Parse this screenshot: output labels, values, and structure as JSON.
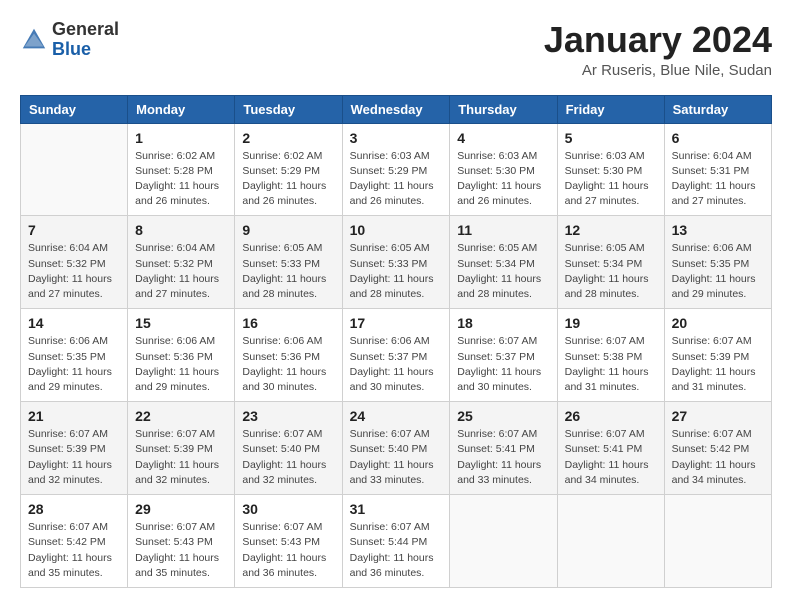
{
  "header": {
    "logo_general": "General",
    "logo_blue": "Blue",
    "month_title": "January 2024",
    "location": "Ar Ruseris, Blue Nile, Sudan"
  },
  "weekdays": [
    "Sunday",
    "Monday",
    "Tuesday",
    "Wednesday",
    "Thursday",
    "Friday",
    "Saturday"
  ],
  "weeks": [
    [
      {
        "day": "",
        "sunrise": "",
        "sunset": "",
        "daylight": ""
      },
      {
        "day": "1",
        "sunrise": "Sunrise: 6:02 AM",
        "sunset": "Sunset: 5:28 PM",
        "daylight": "Daylight: 11 hours and 26 minutes."
      },
      {
        "day": "2",
        "sunrise": "Sunrise: 6:02 AM",
        "sunset": "Sunset: 5:29 PM",
        "daylight": "Daylight: 11 hours and 26 minutes."
      },
      {
        "day": "3",
        "sunrise": "Sunrise: 6:03 AM",
        "sunset": "Sunset: 5:29 PM",
        "daylight": "Daylight: 11 hours and 26 minutes."
      },
      {
        "day": "4",
        "sunrise": "Sunrise: 6:03 AM",
        "sunset": "Sunset: 5:30 PM",
        "daylight": "Daylight: 11 hours and 26 minutes."
      },
      {
        "day": "5",
        "sunrise": "Sunrise: 6:03 AM",
        "sunset": "Sunset: 5:30 PM",
        "daylight": "Daylight: 11 hours and 27 minutes."
      },
      {
        "day": "6",
        "sunrise": "Sunrise: 6:04 AM",
        "sunset": "Sunset: 5:31 PM",
        "daylight": "Daylight: 11 hours and 27 minutes."
      }
    ],
    [
      {
        "day": "7",
        "sunrise": "Sunrise: 6:04 AM",
        "sunset": "Sunset: 5:32 PM",
        "daylight": "Daylight: 11 hours and 27 minutes."
      },
      {
        "day": "8",
        "sunrise": "Sunrise: 6:04 AM",
        "sunset": "Sunset: 5:32 PM",
        "daylight": "Daylight: 11 hours and 27 minutes."
      },
      {
        "day": "9",
        "sunrise": "Sunrise: 6:05 AM",
        "sunset": "Sunset: 5:33 PM",
        "daylight": "Daylight: 11 hours and 28 minutes."
      },
      {
        "day": "10",
        "sunrise": "Sunrise: 6:05 AM",
        "sunset": "Sunset: 5:33 PM",
        "daylight": "Daylight: 11 hours and 28 minutes."
      },
      {
        "day": "11",
        "sunrise": "Sunrise: 6:05 AM",
        "sunset": "Sunset: 5:34 PM",
        "daylight": "Daylight: 11 hours and 28 minutes."
      },
      {
        "day": "12",
        "sunrise": "Sunrise: 6:05 AM",
        "sunset": "Sunset: 5:34 PM",
        "daylight": "Daylight: 11 hours and 28 minutes."
      },
      {
        "day": "13",
        "sunrise": "Sunrise: 6:06 AM",
        "sunset": "Sunset: 5:35 PM",
        "daylight": "Daylight: 11 hours and 29 minutes."
      }
    ],
    [
      {
        "day": "14",
        "sunrise": "Sunrise: 6:06 AM",
        "sunset": "Sunset: 5:35 PM",
        "daylight": "Daylight: 11 hours and 29 minutes."
      },
      {
        "day": "15",
        "sunrise": "Sunrise: 6:06 AM",
        "sunset": "Sunset: 5:36 PM",
        "daylight": "Daylight: 11 hours and 29 minutes."
      },
      {
        "day": "16",
        "sunrise": "Sunrise: 6:06 AM",
        "sunset": "Sunset: 5:36 PM",
        "daylight": "Daylight: 11 hours and 30 minutes."
      },
      {
        "day": "17",
        "sunrise": "Sunrise: 6:06 AM",
        "sunset": "Sunset: 5:37 PM",
        "daylight": "Daylight: 11 hours and 30 minutes."
      },
      {
        "day": "18",
        "sunrise": "Sunrise: 6:07 AM",
        "sunset": "Sunset: 5:37 PM",
        "daylight": "Daylight: 11 hours and 30 minutes."
      },
      {
        "day": "19",
        "sunrise": "Sunrise: 6:07 AM",
        "sunset": "Sunset: 5:38 PM",
        "daylight": "Daylight: 11 hours and 31 minutes."
      },
      {
        "day": "20",
        "sunrise": "Sunrise: 6:07 AM",
        "sunset": "Sunset: 5:39 PM",
        "daylight": "Daylight: 11 hours and 31 minutes."
      }
    ],
    [
      {
        "day": "21",
        "sunrise": "Sunrise: 6:07 AM",
        "sunset": "Sunset: 5:39 PM",
        "daylight": "Daylight: 11 hours and 32 minutes."
      },
      {
        "day": "22",
        "sunrise": "Sunrise: 6:07 AM",
        "sunset": "Sunset: 5:39 PM",
        "daylight": "Daylight: 11 hours and 32 minutes."
      },
      {
        "day": "23",
        "sunrise": "Sunrise: 6:07 AM",
        "sunset": "Sunset: 5:40 PM",
        "daylight": "Daylight: 11 hours and 32 minutes."
      },
      {
        "day": "24",
        "sunrise": "Sunrise: 6:07 AM",
        "sunset": "Sunset: 5:40 PM",
        "daylight": "Daylight: 11 hours and 33 minutes."
      },
      {
        "day": "25",
        "sunrise": "Sunrise: 6:07 AM",
        "sunset": "Sunset: 5:41 PM",
        "daylight": "Daylight: 11 hours and 33 minutes."
      },
      {
        "day": "26",
        "sunrise": "Sunrise: 6:07 AM",
        "sunset": "Sunset: 5:41 PM",
        "daylight": "Daylight: 11 hours and 34 minutes."
      },
      {
        "day": "27",
        "sunrise": "Sunrise: 6:07 AM",
        "sunset": "Sunset: 5:42 PM",
        "daylight": "Daylight: 11 hours and 34 minutes."
      }
    ],
    [
      {
        "day": "28",
        "sunrise": "Sunrise: 6:07 AM",
        "sunset": "Sunset: 5:42 PM",
        "daylight": "Daylight: 11 hours and 35 minutes."
      },
      {
        "day": "29",
        "sunrise": "Sunrise: 6:07 AM",
        "sunset": "Sunset: 5:43 PM",
        "daylight": "Daylight: 11 hours and 35 minutes."
      },
      {
        "day": "30",
        "sunrise": "Sunrise: 6:07 AM",
        "sunset": "Sunset: 5:43 PM",
        "daylight": "Daylight: 11 hours and 36 minutes."
      },
      {
        "day": "31",
        "sunrise": "Sunrise: 6:07 AM",
        "sunset": "Sunset: 5:44 PM",
        "daylight": "Daylight: 11 hours and 36 minutes."
      },
      {
        "day": "",
        "sunrise": "",
        "sunset": "",
        "daylight": ""
      },
      {
        "day": "",
        "sunrise": "",
        "sunset": "",
        "daylight": ""
      },
      {
        "day": "",
        "sunrise": "",
        "sunset": "",
        "daylight": ""
      }
    ]
  ]
}
